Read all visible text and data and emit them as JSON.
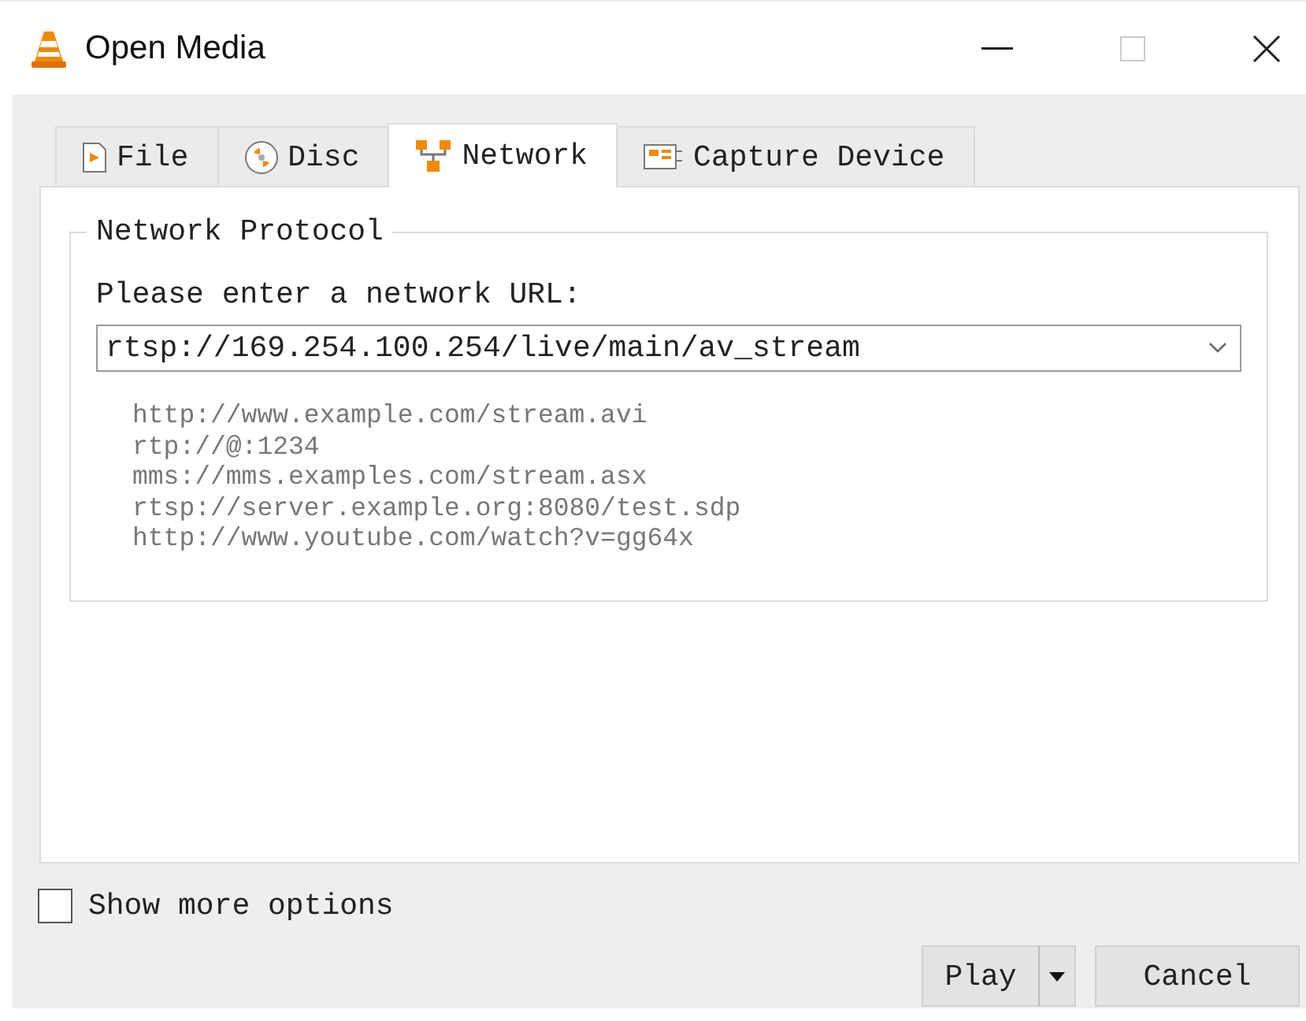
{
  "window": {
    "title": "Open Media"
  },
  "tabs": [
    {
      "label": "File",
      "kind": "file",
      "selected": false
    },
    {
      "label": "Disc",
      "kind": "disc",
      "selected": false
    },
    {
      "label": "Network",
      "kind": "network",
      "selected": true
    },
    {
      "label": "Capture Device",
      "kind": "capture",
      "selected": false
    }
  ],
  "group": {
    "title": "Network Protocol",
    "prompt": "Please enter a network URL:",
    "url": "rtsp://169.254.100.254/live/main/av_stream",
    "examples": [
      "http://www.example.com/stream.avi",
      "rtp://@:1234",
      "mms://mms.examples.com/stream.asx",
      "rtsp://server.example.org:8080/test.sdp",
      "http://www.youtube.com/watch?v=gg64x"
    ]
  },
  "show_more_options": {
    "label": "Show more options",
    "checked": false
  },
  "buttons": [
    {
      "label": "Play",
      "kind": "split"
    },
    {
      "label": "Cancel",
      "kind": "plain"
    }
  ]
}
